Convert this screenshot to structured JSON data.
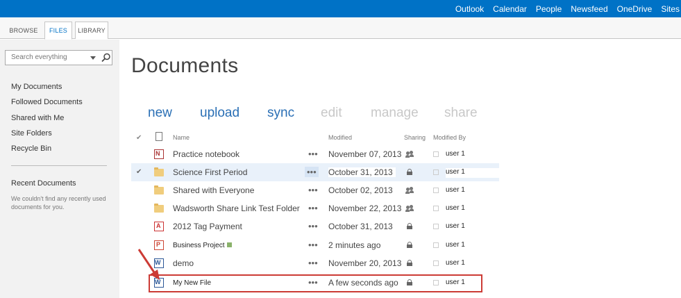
{
  "suitebar": {
    "links": [
      "Outlook",
      "Calendar",
      "People",
      "Newsfeed",
      "OneDrive",
      "Sites"
    ]
  },
  "ribbon": {
    "tabs": [
      "BROWSE",
      "FILES",
      "LIBRARY"
    ]
  },
  "search": {
    "placeholder": "Search everything"
  },
  "leftnav": {
    "items": [
      "My Documents",
      "Followed Documents",
      "Shared with Me",
      "Site Folders",
      "Recycle Bin"
    ],
    "recent_title": "Recent Documents",
    "recent_msg": "We couldn't find any recently used documents for you."
  },
  "main": {
    "title": "Documents",
    "commands": [
      "new",
      "upload",
      "sync",
      "edit",
      "manage",
      "share"
    ],
    "columns": {
      "name": "Name",
      "modified": "Modified",
      "sharing": "Sharing",
      "modified_by": "Modified By"
    },
    "rows": [
      {
        "name": "Practice notebook",
        "modified": "November 07, 2013",
        "user": "user 1",
        "type": "onenote",
        "sharing": "people"
      },
      {
        "name": "Science First Period",
        "modified": "October 31, 2013",
        "user": "user 1",
        "type": "folder",
        "sharing": "lock"
      },
      {
        "name": "Shared with Everyone",
        "modified": "October 02, 2013",
        "user": "user 1",
        "type": "folder",
        "sharing": "people"
      },
      {
        "name": "Wadsworth Share Link Test Folder",
        "modified": "November 22, 2013",
        "user": "user 1",
        "type": "folder",
        "sharing": "people"
      },
      {
        "name": "2012 Tag Payment",
        "modified": "October 31, 2013",
        "user": "user 1",
        "type": "pdf",
        "sharing": "lock"
      },
      {
        "name": "Business Project",
        "modified": "2 minutes ago",
        "user": "user 1",
        "type": "ppt",
        "sharing": "lock"
      },
      {
        "name": "demo",
        "modified": "November 20, 2013",
        "user": "user 1",
        "type": "word",
        "sharing": "lock"
      },
      {
        "name": "My New File",
        "modified": "A few seconds ago",
        "user": "user 1",
        "type": "word",
        "sharing": "lock"
      }
    ]
  },
  "colors": {
    "suitebar": "#0072c6",
    "command_active": "#2a6fb5",
    "command_disabled": "#c8c8c8",
    "highlight": "#cc3b35"
  }
}
